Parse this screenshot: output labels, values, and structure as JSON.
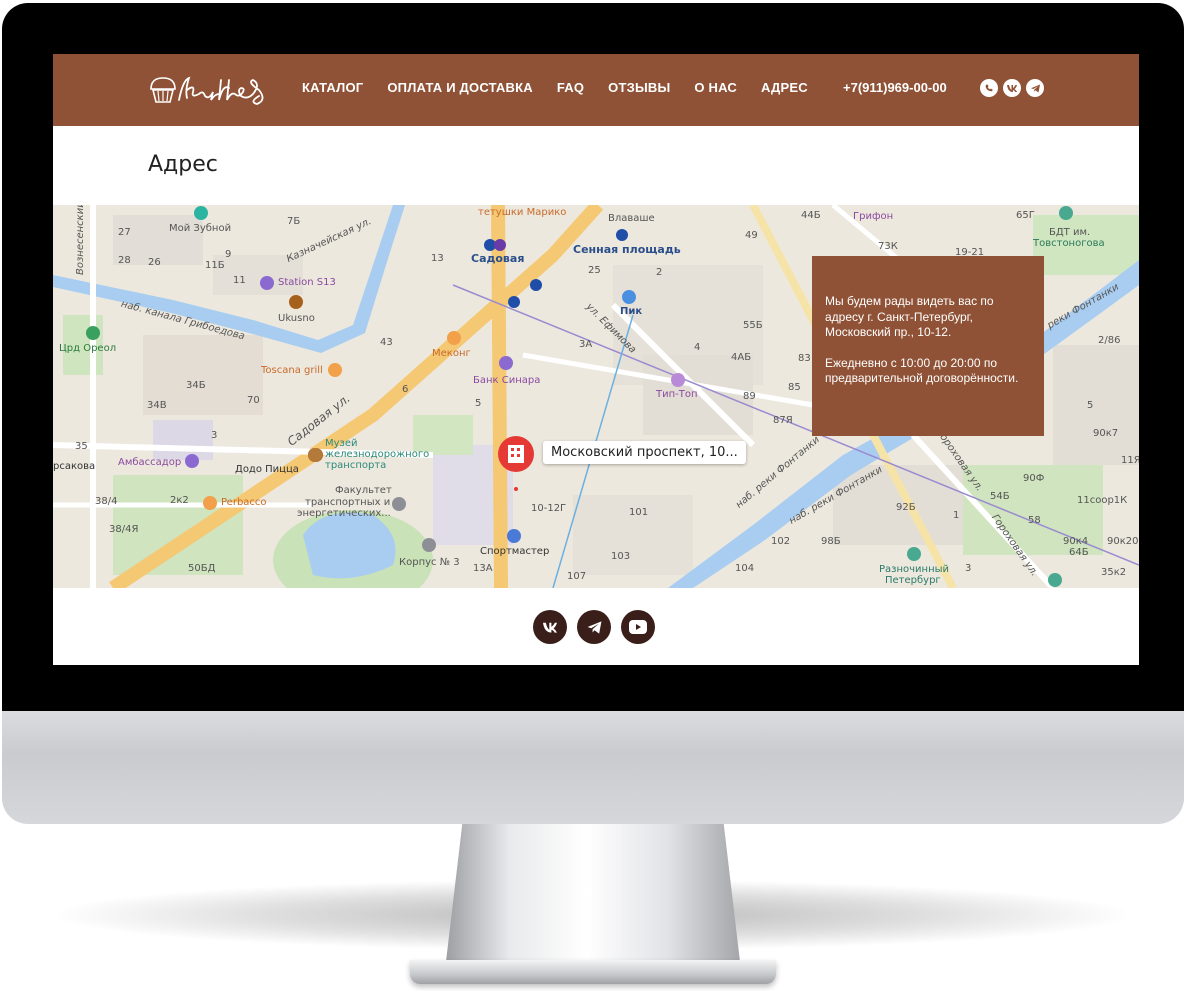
{
  "brand": {
    "logo_text": "Kruffles"
  },
  "nav": {
    "items": [
      {
        "label": "КАТАЛОГ"
      },
      {
        "label": "ОПЛАТА И ДОСТАВКА"
      },
      {
        "label": "FAQ"
      },
      {
        "label": "ОТЗЫВЫ"
      },
      {
        "label": "О НАС"
      },
      {
        "label": "АДРЕС",
        "active": true
      }
    ],
    "phone": "+7(911)969-00-00",
    "social_icons": [
      "whatsapp-icon",
      "vk-icon",
      "telegram-icon"
    ]
  },
  "page": {
    "title": "Адрес"
  },
  "map": {
    "pin_label": "Московский проспект, 10...",
    "labels": {
      "moy_zubnoy": "Мой Зубной",
      "station": "Station S13",
      "ukusno": "Ukusno",
      "tetushki": "тетушки Марико",
      "vlavashe": "Влаваше",
      "sadovaya_metro": "Садовая",
      "sennaya": "Сенная площадь",
      "pik": "Пик",
      "grifon": "Грифон",
      "bdt": "БДТ им.",
      "tovstonogova": "Товстоногова",
      "kanal": "наб. канала Грибоедова",
      "kaznacheyskaya": "Казначейская ул.",
      "voznesensky": "Вознесенский п",
      "crd": "Црд Ореол",
      "toscana": "Toscana grill",
      "mekong": "Меконг",
      "bank": "Банк Синара",
      "tiptop": "Тип-Топ",
      "sadovaya_street": "Садовая ул.",
      "efimova": "ул. Ефимова",
      "muzey_1": "Музей",
      "muzey_2": "железнодорожного",
      "muzey_3": "транспорта",
      "ambassador": "Амбассадор",
      "dodo": "Додо Пицца",
      "perbacco": "Perbacco",
      "fakultet_1": "Факультет",
      "fakultet_2": "транспортных и",
      "fakultet_3": "энергетических...",
      "korpus": "Корпус № 3",
      "sportmaster": "Спортмастер",
      "fontanka1": "наб. реки Фонтанки",
      "fontanka2": "наб. реки Фонтанки",
      "fontanka3": "реки Фонтанки",
      "gorokhovaya1": "Гороховая ул.",
      "gorokhovaya2": "Гороховая ул.",
      "raznochinny_1": "Разночинный",
      "raznochinny_2": "Петербург",
      "sakova": "рсакова"
    },
    "house_numbers": [
      "27",
      "28",
      "26",
      "11Б",
      "9",
      "11",
      "7Б",
      "13",
      "25",
      "2",
      "49",
      "44Б",
      "73К",
      "19-21",
      "65Г",
      "55Б",
      "4АБ",
      "83",
      "85",
      "89",
      "87Я",
      "34Б",
      "34В",
      "70",
      "35",
      "3",
      "5",
      "2к2",
      "38/4",
      "38/4Я",
      "50БД",
      "13А",
      "107",
      "103",
      "104",
      "102",
      "98Б",
      "92Б",
      "58",
      "54Б",
      "90Ф",
      "11соор1К",
      "90к4",
      "64Б",
      "90к20",
      "35к2",
      "2/86",
      "90к7",
      "11Я",
      "10-12Г",
      "101",
      "6",
      "43",
      "3А",
      "4",
      "5",
      "1",
      "3"
    ]
  },
  "info": {
    "address_text": "Мы будем рады видеть вас по адресу г. Санкт-Петербург, Московский пр., 10-12.",
    "hours_text": "Ежедневно с 10:00 до 20:00 по предварительной договорённости."
  },
  "footer": {
    "social_icons": [
      "vk-icon",
      "telegram-icon",
      "youtube-icon"
    ]
  },
  "colors": {
    "brand_brown": "#8f5236",
    "footer_icon": "#3a1e1a"
  }
}
